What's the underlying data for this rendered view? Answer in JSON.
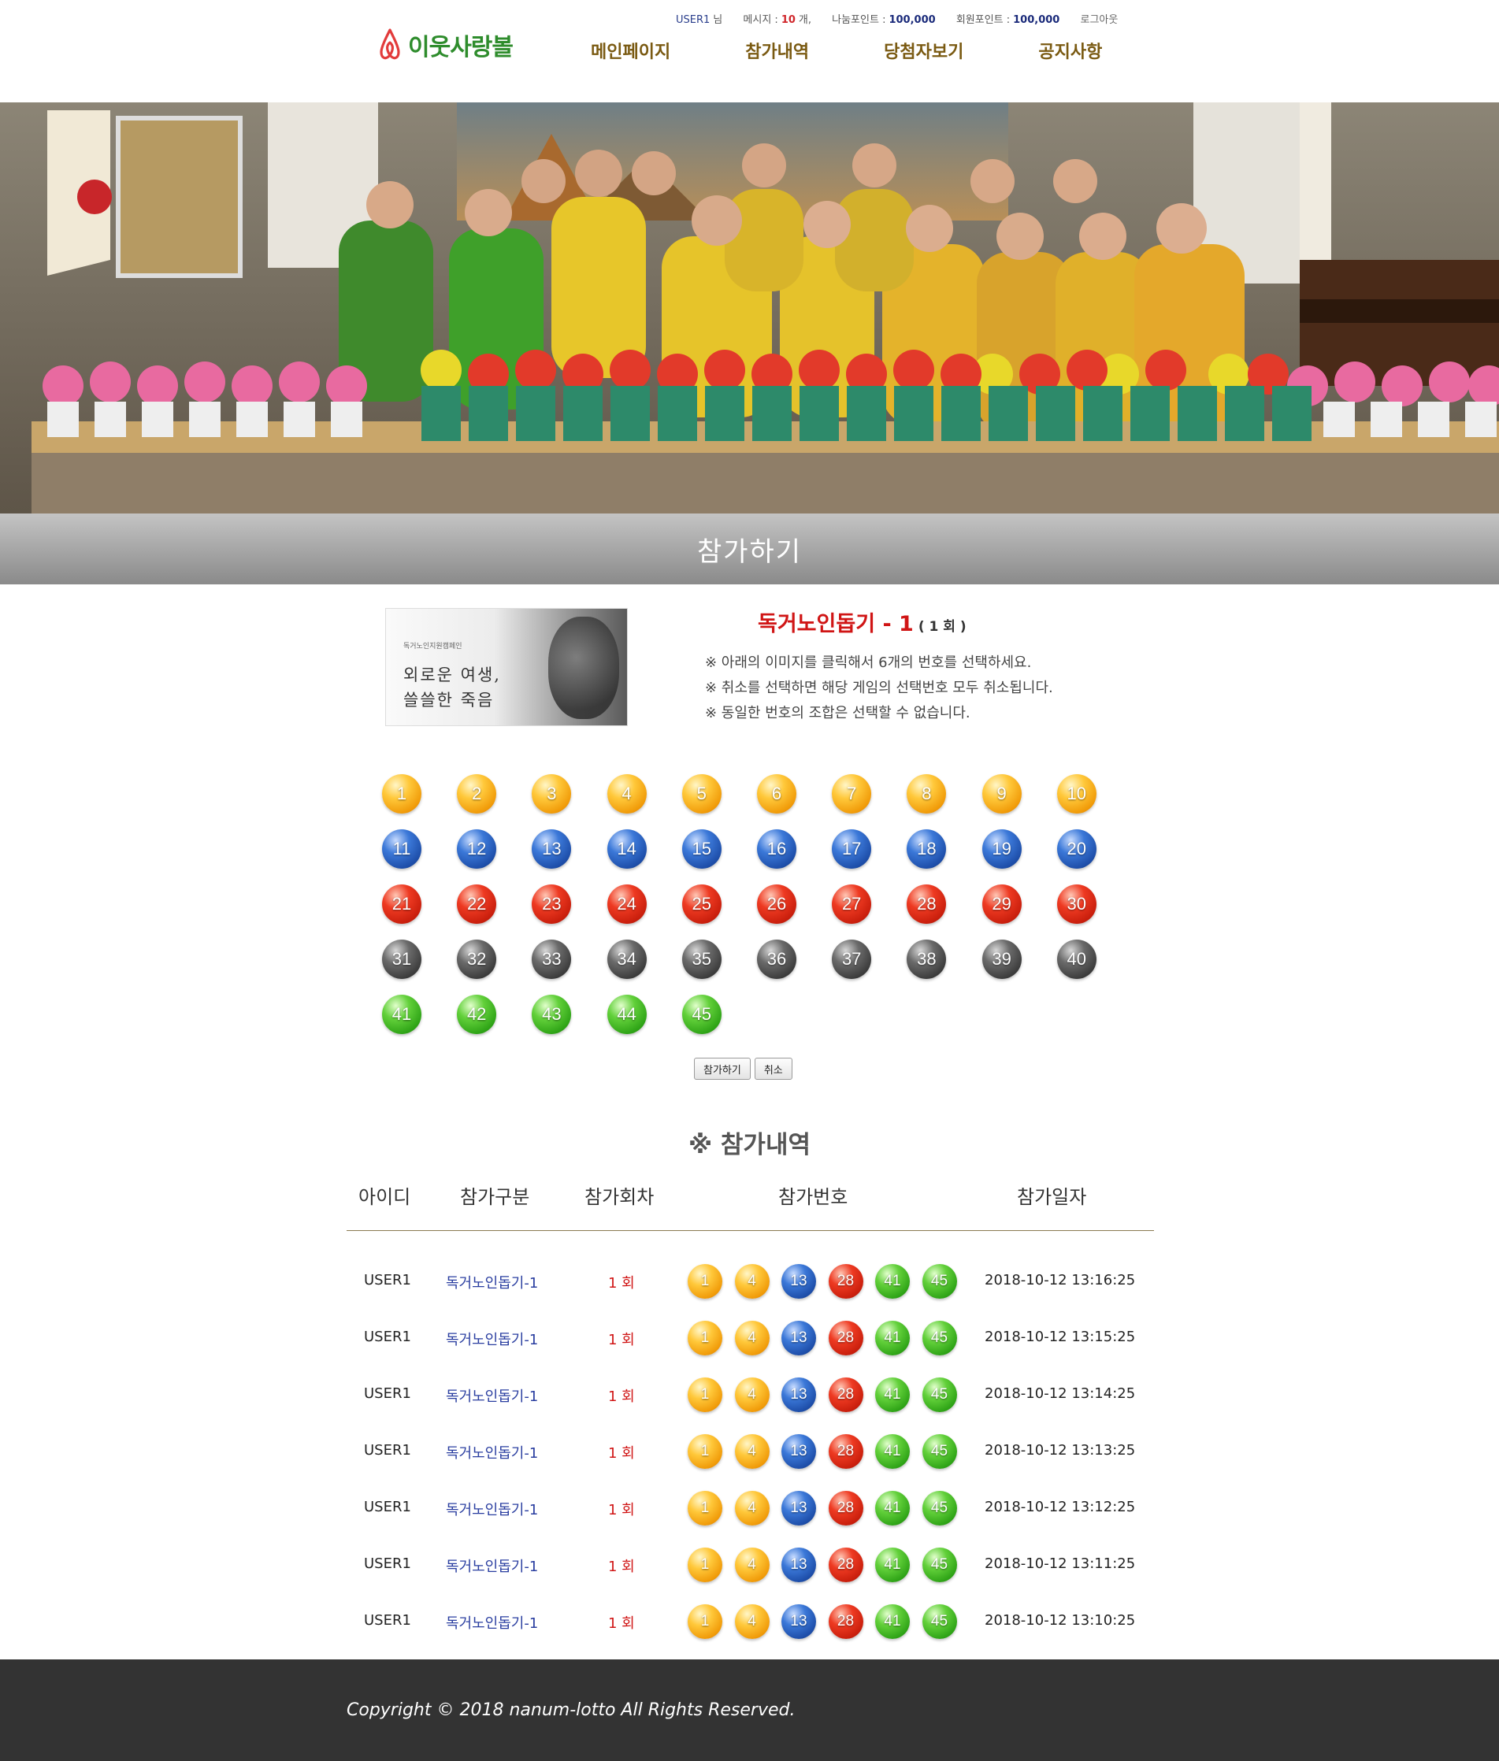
{
  "header": {
    "user_id": "USER1",
    "user_suffix": "님",
    "message_label": "메시지 :",
    "message_count": "10",
    "message_unit": "개,",
    "share_points_label": "나눔포인트 :",
    "share_points": "100,000",
    "member_points_label": "회원포인트 :",
    "member_points": "100,000",
    "logout_label": "로그아웃",
    "logo_text": "이웃사랑볼",
    "nav": [
      "메인페이지",
      "참가내역",
      "당첨자보기",
      "공지사항"
    ]
  },
  "banner": {
    "title": "참가하기"
  },
  "game": {
    "thumb_small": "독거노인지원캠페인",
    "thumb_line1": "외로운 여생,",
    "thumb_line2": "쓸쓸한 죽음",
    "title": "독거노인돕기 - 1",
    "round_badge": "( 1 회 )",
    "notes": [
      "※ 아래의 이미지를 클릭해서 6개의 번호를 선택하세요.",
      "※ 취소를 선택하면 해당 게임의 선택번호 모두 취소됩니다.",
      "※ 동일한 번호의 조합은 선택할 수 없습니다."
    ]
  },
  "ball_colors": {
    "yellow": "#f5a81a",
    "blue": "#2a5fc0",
    "red": "#d82a16",
    "gray": "#4a4a4a",
    "green": "#3eb81f"
  },
  "numbers": [
    1,
    2,
    3,
    4,
    5,
    6,
    7,
    8,
    9,
    10,
    11,
    12,
    13,
    14,
    15,
    16,
    17,
    18,
    19,
    20,
    21,
    22,
    23,
    24,
    25,
    26,
    27,
    28,
    29,
    30,
    31,
    32,
    33,
    34,
    35,
    36,
    37,
    38,
    39,
    40,
    41,
    42,
    43,
    44,
    45
  ],
  "buttons": {
    "join": "참가하기",
    "cancel": "취소"
  },
  "history": {
    "title": "※ 참가내역",
    "headers": [
      "아이디",
      "참가구분",
      "참가회차",
      "참가번호",
      "참가일자"
    ],
    "rows": [
      {
        "id": "USER1",
        "kind": "독거노인돕기-1",
        "round": "1 회",
        "numbers": [
          1,
          4,
          13,
          28,
          41,
          45
        ],
        "date": "2018-10-12 13:16:25"
      },
      {
        "id": "USER1",
        "kind": "독거노인돕기-1",
        "round": "1 회",
        "numbers": [
          1,
          4,
          13,
          28,
          41,
          45
        ],
        "date": "2018-10-12 13:15:25"
      },
      {
        "id": "USER1",
        "kind": "독거노인돕기-1",
        "round": "1 회",
        "numbers": [
          1,
          4,
          13,
          28,
          41,
          45
        ],
        "date": "2018-10-12 13:14:25"
      },
      {
        "id": "USER1",
        "kind": "독거노인돕기-1",
        "round": "1 회",
        "numbers": [
          1,
          4,
          13,
          28,
          41,
          45
        ],
        "date": "2018-10-12 13:13:25"
      },
      {
        "id": "USER1",
        "kind": "독거노인돕기-1",
        "round": "1 회",
        "numbers": [
          1,
          4,
          13,
          28,
          41,
          45
        ],
        "date": "2018-10-12 13:12:25"
      },
      {
        "id": "USER1",
        "kind": "독거노인돕기-1",
        "round": "1 회",
        "numbers": [
          1,
          4,
          13,
          28,
          41,
          45
        ],
        "date": "2018-10-12 13:11:25"
      },
      {
        "id": "USER1",
        "kind": "독거노인돕기-1",
        "round": "1 회",
        "numbers": [
          1,
          4,
          13,
          28,
          41,
          45
        ],
        "date": "2018-10-12 13:10:25"
      }
    ]
  },
  "footer": {
    "copyright": "Copyright © 2018 nanum-lotto All Rights Reserved."
  }
}
